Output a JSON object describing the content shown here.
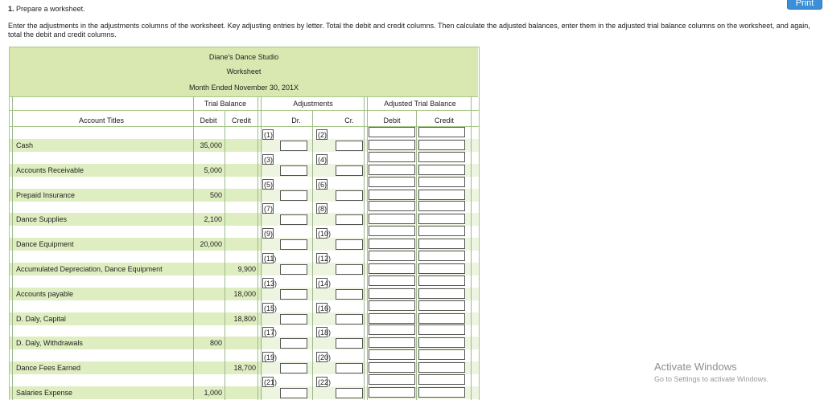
{
  "print_label": "Print",
  "question": {
    "number": "1.",
    "title": "Prepare a worksheet.",
    "instructions": "Enter the adjustments in the adjustments columns of the worksheet. Key adjusting entries by letter. Total the debit and credit columns. Then calculate the adjusted balances, enter them in the adjusted trial balance columns on the worksheet, and again, total the debit and credit columns."
  },
  "worksheet": {
    "company": "Diane's Dance Studio",
    "title": "Worksheet",
    "period": "Month Ended November 30, 201X",
    "headers": {
      "account_titles": "Account Titles",
      "trial_balance": "Trial Balance",
      "adjustments": "Adjustments",
      "adjusted_trial_balance": "Adjusted Trial Balance",
      "debit": "Debit",
      "credit": "Credit",
      "dr": "Dr.",
      "cr": "Cr."
    },
    "rows": [
      {
        "account": "Cash",
        "debit": "35,000",
        "credit": "",
        "dr_key": "(1)",
        "cr_key": "(2)"
      },
      {
        "account": "Accounts Receivable",
        "debit": "5,000",
        "credit": "",
        "dr_key": "(3)",
        "cr_key": "(4)"
      },
      {
        "account": "Prepaid Insurance",
        "debit": "500",
        "credit": "",
        "dr_key": "(5)",
        "cr_key": "(6)"
      },
      {
        "account": "Dance Supplies",
        "debit": "2,100",
        "credit": "",
        "dr_key": "(7)",
        "cr_key": "(8)"
      },
      {
        "account": "Dance Equipment",
        "debit": "20,000",
        "credit": "",
        "dr_key": "(9)",
        "cr_key": "(10)"
      },
      {
        "account": "Accumulated Depreciation, Dance Equipment",
        "debit": "",
        "credit": "9,900",
        "dr_key": "(11)",
        "cr_key": "(12)"
      },
      {
        "account": "Accounts payable",
        "debit": "",
        "credit": "18,000",
        "dr_key": "(13)",
        "cr_key": "(14)"
      },
      {
        "account": "D. Daly, Capital",
        "debit": "",
        "credit": "18,800",
        "dr_key": "(15)",
        "cr_key": "(16)"
      },
      {
        "account": "D. Daly, Withdrawals",
        "debit": "800",
        "credit": "",
        "dr_key": "(17)",
        "cr_key": "(18)"
      },
      {
        "account": "Dance Fees Earned",
        "debit": "",
        "credit": "18,700",
        "dr_key": "(19)",
        "cr_key": "(20)"
      },
      {
        "account": "Salaries Expense",
        "debit": "1,000",
        "credit": "",
        "dr_key": "(21)",
        "cr_key": "(22)"
      }
    ]
  },
  "watermark": {
    "line1": "Activate Windows",
    "line2": "Go to Settings to activate Windows."
  }
}
